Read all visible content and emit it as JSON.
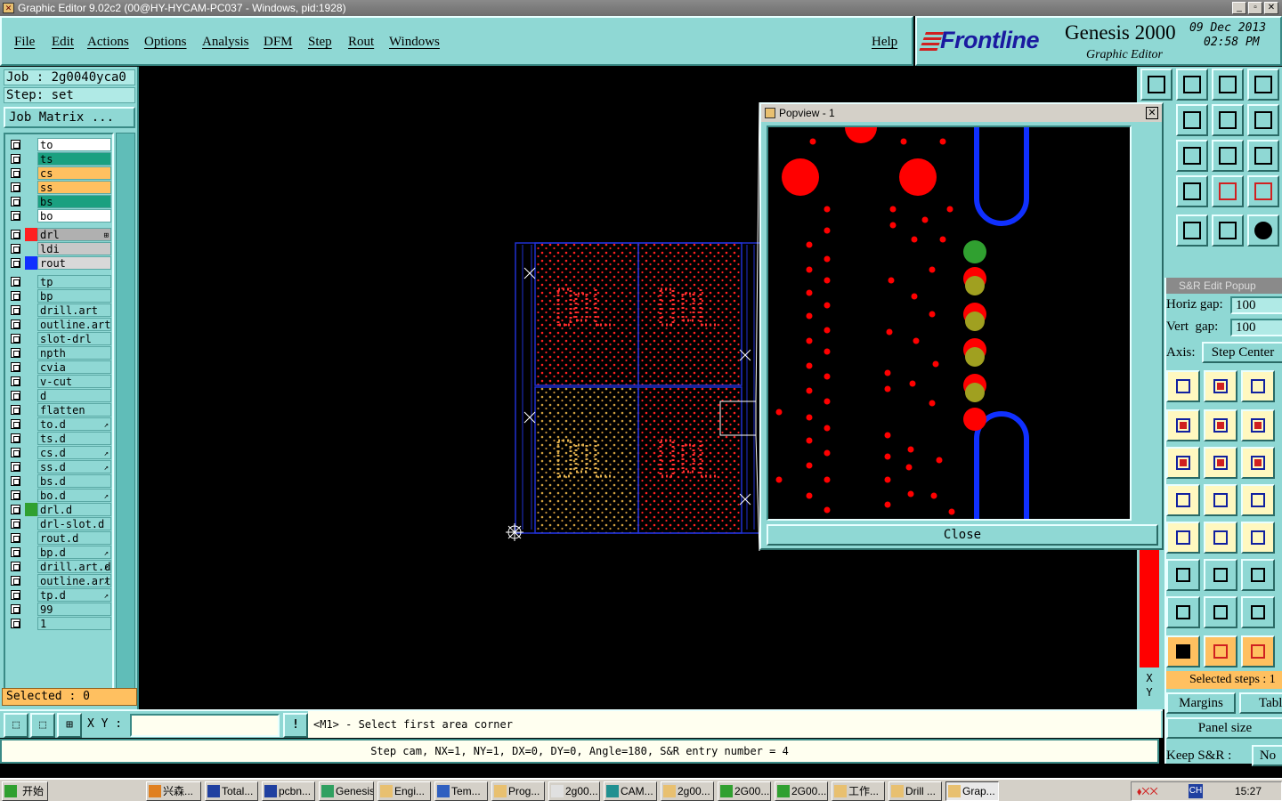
{
  "window": {
    "title": "Graphic Editor 9.02c2 (00@HY-HYCAM-PC037 - Windows, pid:1928)"
  },
  "menu": {
    "items": [
      "File",
      "Edit",
      "Actions",
      "Options",
      "Analysis",
      "DFM",
      "Step",
      "Rout",
      "Windows"
    ],
    "help": "Help"
  },
  "brand": {
    "logo": "Frontline",
    "product": "Genesis 2000",
    "subtitle": "Graphic Editor",
    "date": "09 Dec 2013",
    "time": "02:58 PM"
  },
  "job": {
    "job_line": "Job : 2g0040yca0",
    "step_line": "Step: set",
    "matrix_button": "Job Matrix ..."
  },
  "layers": [
    {
      "name": "to",
      "color": "#ffffff"
    },
    {
      "name": "ts",
      "color": "#1aa080"
    },
    {
      "name": "cs",
      "color": "#ffc060"
    },
    {
      "name": "ss",
      "color": "#ffc060"
    },
    {
      "name": "bs",
      "color": "#1aa080"
    },
    {
      "name": "bo",
      "color": "#ffffff"
    },
    {
      "name": "drl",
      "color": "#b0b0b0",
      "swatch": "#ff2020",
      "active": true,
      "mark": "⊞"
    },
    {
      "name": "ldi",
      "color": "#c8c8c8"
    },
    {
      "name": "rout",
      "color": "#d8d8d8",
      "swatch": "#1030ff"
    },
    {
      "name": "tp",
      "color": "#8fd8d4"
    },
    {
      "name": "bp",
      "color": "#8fd8d4"
    },
    {
      "name": "drill.art",
      "color": "#8fd8d4"
    },
    {
      "name": "outline.art",
      "color": "#8fd8d4"
    },
    {
      "name": "slot-drl",
      "color": "#8fd8d4"
    },
    {
      "name": "npth",
      "color": "#8fd8d4"
    },
    {
      "name": "cvia",
      "color": "#8fd8d4"
    },
    {
      "name": "v-cut",
      "color": "#8fd8d4"
    },
    {
      "name": "d",
      "color": "#8fd8d4"
    },
    {
      "name": "flatten",
      "color": "#8fd8d4"
    },
    {
      "name": "to.d",
      "color": "#8fd8d4",
      "mark": "↗"
    },
    {
      "name": "ts.d",
      "color": "#8fd8d4"
    },
    {
      "name": "cs.d",
      "color": "#8fd8d4",
      "mark": "↗"
    },
    {
      "name": "ss.d",
      "color": "#8fd8d4",
      "mark": "↗"
    },
    {
      "name": "bs.d",
      "color": "#8fd8d4"
    },
    {
      "name": "bo.d",
      "color": "#8fd8d4",
      "mark": "↗"
    },
    {
      "name": "drl.d",
      "color": "#8fd8d4",
      "swatch": "#30a030"
    },
    {
      "name": "drl-slot.d",
      "color": "#8fd8d4"
    },
    {
      "name": "rout.d",
      "color": "#8fd8d4"
    },
    {
      "name": "bp.d",
      "color": "#8fd8d4",
      "mark": "↗"
    },
    {
      "name": "drill.art.d",
      "color": "#8fd8d4",
      "mark": "↗"
    },
    {
      "name": "outline.art.d",
      "color": "#8fd8d4",
      "mark": "↗"
    },
    {
      "name": "tp.d",
      "color": "#8fd8d4",
      "mark": "↗"
    },
    {
      "name": "99",
      "color": "#8fd8d4"
    },
    {
      "name": "1",
      "color": "#8fd8d4"
    }
  ],
  "selected": "Selected : 0",
  "popview": {
    "title": "Popview - 1",
    "close": "Close"
  },
  "snr": {
    "title": "S&R Edit Popup",
    "horiz_label": "Horiz gap:",
    "horiz_value": "100",
    "vert_label": "Vert  gap:",
    "vert_value": "100",
    "axis_label": "Axis:",
    "axis_value": "Step Center",
    "selected_steps": "Selected steps : 1",
    "margins": "Margins",
    "table": "Table",
    "panel_size": "Panel size",
    "keep_label": "Keep S&R  :",
    "keep_value": "No"
  },
  "xy_side": "X\nY",
  "command": {
    "xy_label": "X Y :",
    "xy_value": "",
    "alert": "!",
    "prompt": "<M1> - Select first area corner"
  },
  "status": "Step cam, NX=1, NY=1, DX=0, DY=0, Angle=180, S&R entry number = 4",
  "taskbar": {
    "start": "开始",
    "tasks": [
      "兴森...",
      "Total...",
      "pcbn...",
      "Genesis",
      "Engi...",
      "Tem...",
      "Prog...",
      "2g00...",
      "CAM...",
      "2g00...",
      "2G00...",
      "2G00...",
      "工作...",
      "Drill ...",
      "Grap..."
    ],
    "tray_time": "15:27",
    "tray_lang": "CH"
  }
}
